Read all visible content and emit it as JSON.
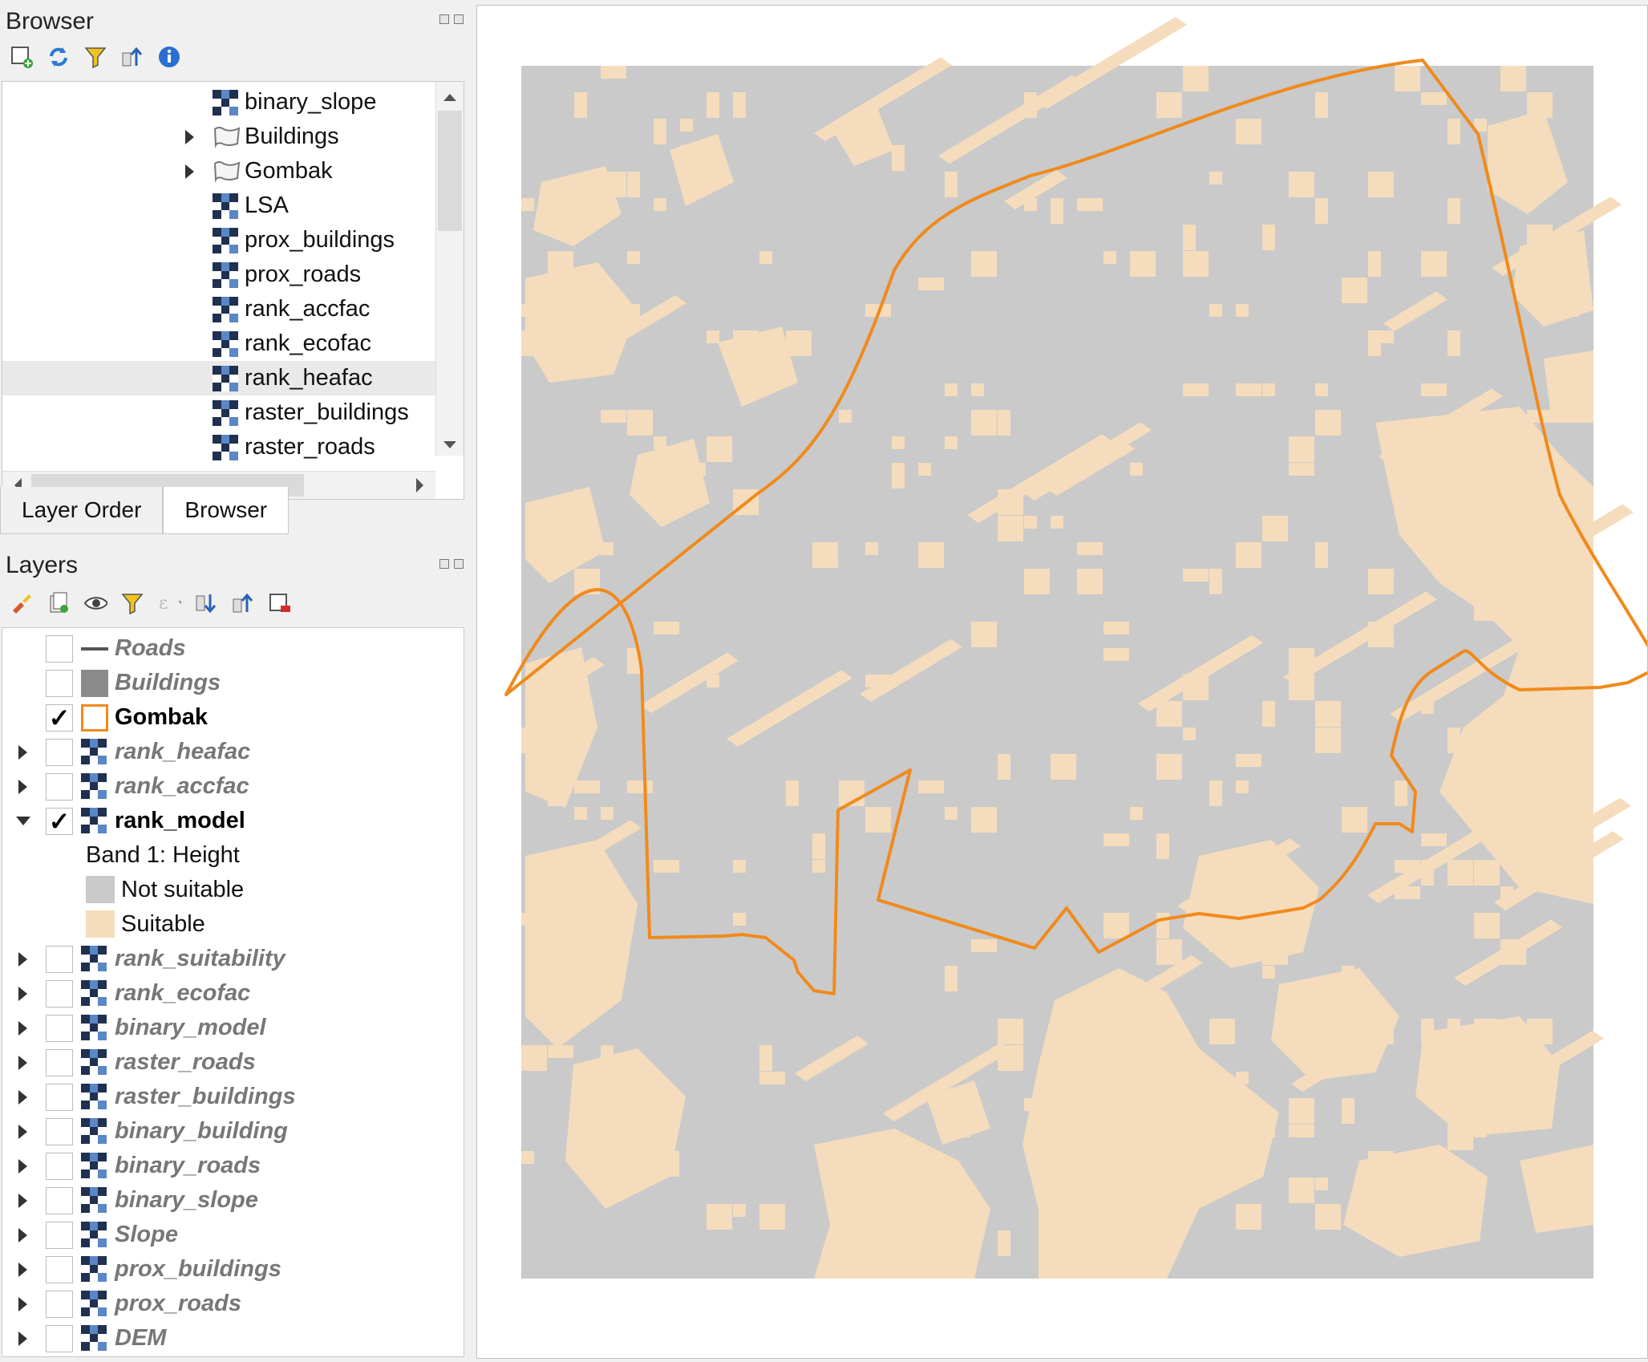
{
  "browser": {
    "title": "Browser",
    "items": [
      {
        "label": "binary_slope",
        "icon": "raster-icon"
      },
      {
        "label": "Buildings",
        "icon": "vector-layer-icon",
        "expandable": true
      },
      {
        "label": "Gombak",
        "icon": "vector-layer-icon",
        "expandable": true
      },
      {
        "label": "LSA",
        "icon": "raster-icon"
      },
      {
        "label": "prox_buildings",
        "icon": "raster-icon"
      },
      {
        "label": "prox_roads",
        "icon": "raster-icon"
      },
      {
        "label": "rank_accfac",
        "icon": "raster-icon"
      },
      {
        "label": "rank_ecofac",
        "icon": "raster-icon"
      },
      {
        "label": "rank_heafac",
        "icon": "raster-icon",
        "selected": true
      },
      {
        "label": "raster_buildings",
        "icon": "raster-icon"
      },
      {
        "label": "raster_roads",
        "icon": "raster-icon"
      }
    ]
  },
  "tabs": [
    "Layer Order",
    "Browser"
  ],
  "layers": {
    "title": "Layers",
    "items": [
      {
        "label": "Roads",
        "visible": false,
        "icon": "line-layer-icon"
      },
      {
        "label": "Buildings",
        "visible": false,
        "icon": "polygon-fill-icon"
      },
      {
        "label": "Gombak",
        "visible": true,
        "icon": "polygon-outline-icon"
      },
      {
        "label": "rank_heafac",
        "visible": false,
        "icon": "raster-icon",
        "expandable": true
      },
      {
        "label": "rank_accfac",
        "visible": false,
        "icon": "raster-icon",
        "expandable": true
      },
      {
        "label": "rank_model",
        "visible": true,
        "icon": "raster-icon",
        "expanded": true
      },
      {
        "label": "rank_suitability",
        "visible": false,
        "icon": "raster-icon",
        "expandable": true
      },
      {
        "label": "rank_ecofac",
        "visible": false,
        "icon": "raster-icon",
        "expandable": true
      },
      {
        "label": "binary_model",
        "visible": false,
        "icon": "raster-icon",
        "expandable": true
      },
      {
        "label": "raster_roads",
        "visible": false,
        "icon": "raster-icon",
        "expandable": true
      },
      {
        "label": "raster_buildings",
        "visible": false,
        "icon": "raster-icon",
        "expandable": true
      },
      {
        "label": "binary_building",
        "visible": false,
        "icon": "raster-icon",
        "expandable": true
      },
      {
        "label": "binary_roads",
        "visible": false,
        "icon": "raster-icon",
        "expandable": true
      },
      {
        "label": "binary_slope",
        "visible": false,
        "icon": "raster-icon",
        "expandable": true
      },
      {
        "label": "Slope",
        "visible": false,
        "icon": "raster-icon",
        "expandable": true
      },
      {
        "label": "prox_buildings",
        "visible": false,
        "icon": "raster-icon",
        "expandable": true
      },
      {
        "label": "prox_roads",
        "visible": false,
        "icon": "raster-icon",
        "expandable": true
      },
      {
        "label": "DEM",
        "visible": false,
        "icon": "raster-icon",
        "expandable": true
      }
    ],
    "legend": {
      "band": "Band 1: Height",
      "classes": [
        {
          "label": "Not suitable",
          "color": "#cacaca"
        },
        {
          "label": "Suitable",
          "color": "#f5dcbc"
        }
      ]
    }
  },
  "map": {
    "raster_classes": [
      "Not suitable",
      "Suitable"
    ],
    "boundary_layer": "Gombak",
    "boundary_color": "#f08a1c"
  }
}
